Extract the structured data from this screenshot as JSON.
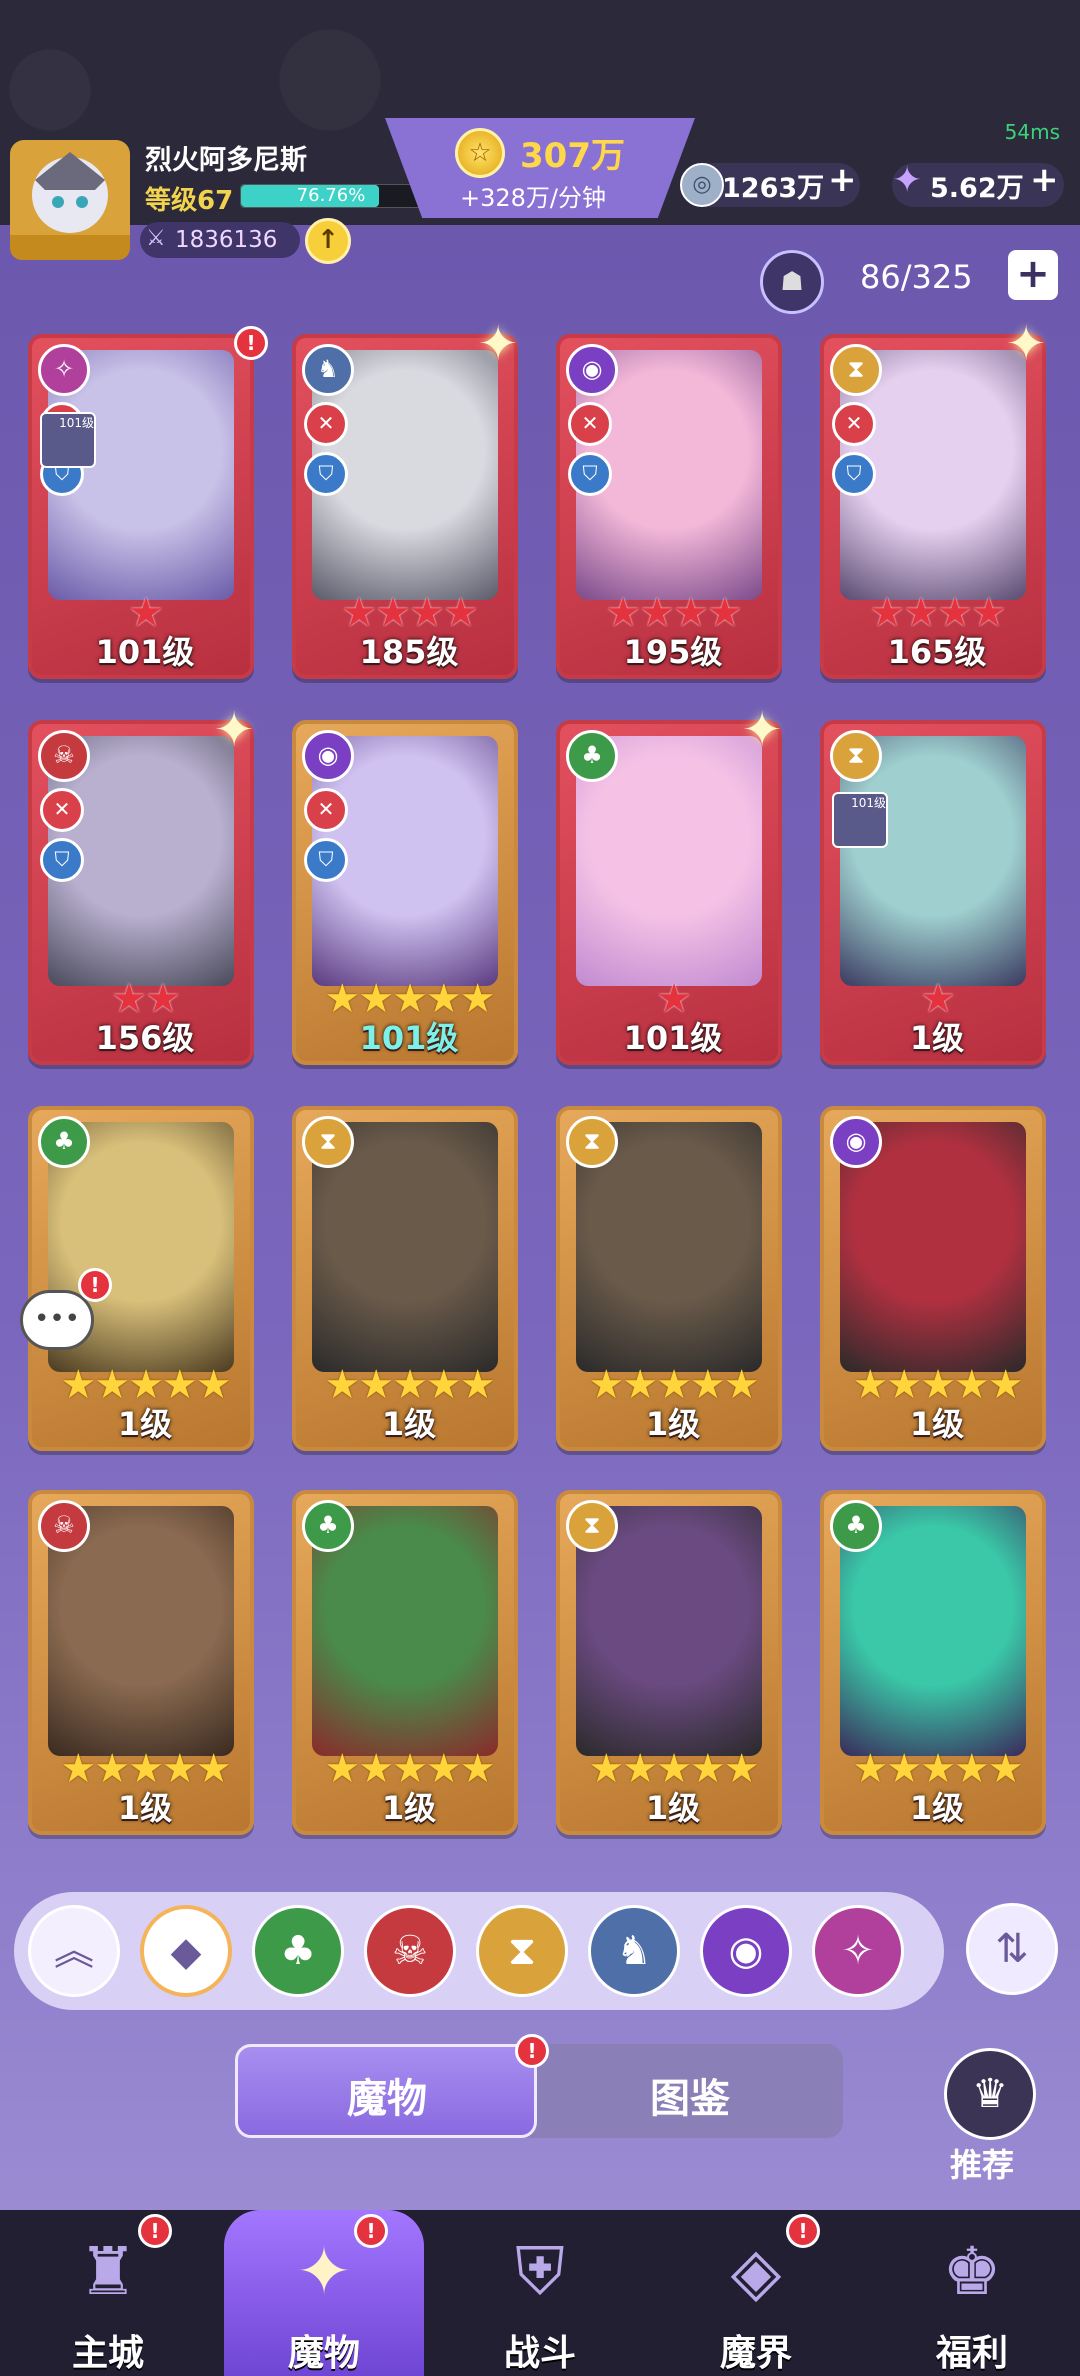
{
  "header": {
    "player_name": "烈火阿多尼斯",
    "level_label": "等级67",
    "xp_percent": "76.76%",
    "xp_fraction": 0.7676,
    "power": "1836136",
    "ping": "54ms",
    "gold": "307万",
    "gold_rate": "+328万/分钟",
    "resource_1": "1263万",
    "resource_2": "5.62万",
    "plus": "+"
  },
  "roster": {
    "count": "86/325",
    "add_symbol": "+"
  },
  "cards": [
    {
      "level": "101级",
      "stars": "★",
      "star_color": "red",
      "frame": "red"
    },
    {
      "level": "185级",
      "stars": "★★★★",
      "star_color": "red",
      "frame": "red"
    },
    {
      "level": "195级",
      "stars": "★★★★",
      "star_color": "red",
      "frame": "red"
    },
    {
      "level": "165级",
      "stars": "★★★★",
      "star_color": "red",
      "frame": "red"
    },
    {
      "level": "156级",
      "stars": "★★",
      "star_color": "red",
      "frame": "red"
    },
    {
      "level": "101级",
      "stars": "★★★★★",
      "star_color": "yellow",
      "frame": "gold"
    },
    {
      "level": "101级",
      "stars": "★",
      "star_color": "red",
      "frame": "red"
    },
    {
      "level": "1级",
      "stars": "★",
      "star_color": "red",
      "frame": "red"
    },
    {
      "level": "1级",
      "stars": "★★★★★",
      "star_color": "yellow",
      "frame": "gold"
    },
    {
      "level": "1级",
      "stars": "★★★★★",
      "star_color": "yellow",
      "frame": "gold"
    },
    {
      "level": "1级",
      "stars": "★★★★★",
      "star_color": "yellow",
      "frame": "gold"
    },
    {
      "level": "1级",
      "stars": "★★★★★",
      "star_color": "yellow",
      "frame": "gold"
    },
    {
      "level": "1级",
      "stars": "★★★★★",
      "star_color": "yellow",
      "frame": "gold"
    },
    {
      "level": "1级",
      "stars": "★★★★★",
      "star_color": "yellow",
      "frame": "gold"
    },
    {
      "level": "1级",
      "stars": "★★★★★",
      "star_color": "yellow",
      "frame": "gold"
    },
    {
      "level": "1级",
      "stars": "★★★★★",
      "star_color": "yellow",
      "frame": "gold"
    }
  ],
  "mini_level": "101级",
  "filters": [
    {
      "name": "collapse-icon",
      "color": "#f3efff"
    },
    {
      "name": "all-factions-icon",
      "color": "#ffffff"
    },
    {
      "name": "nature-faction-icon",
      "color": "#3d9a48"
    },
    {
      "name": "beast-faction-icon",
      "color": "#c53a3f"
    },
    {
      "name": "hourglass-faction-icon",
      "color": "#d9a23a"
    },
    {
      "name": "dragon-faction-icon",
      "color": "#4f6fa8"
    },
    {
      "name": "eye-faction-icon",
      "color": "#7a3fc2"
    },
    {
      "name": "chaos-faction-icon",
      "color": "#b0409c"
    }
  ],
  "tabs": {
    "monster": "魔物",
    "codex": "图鉴"
  },
  "recommend": "推荐",
  "nav": [
    "主城",
    "魔物",
    "战斗",
    "魔界",
    "福利"
  ],
  "colors": {
    "accent": "#8a6ae0",
    "nav_bg": "#221f33",
    "gold": "#ffd84a"
  }
}
